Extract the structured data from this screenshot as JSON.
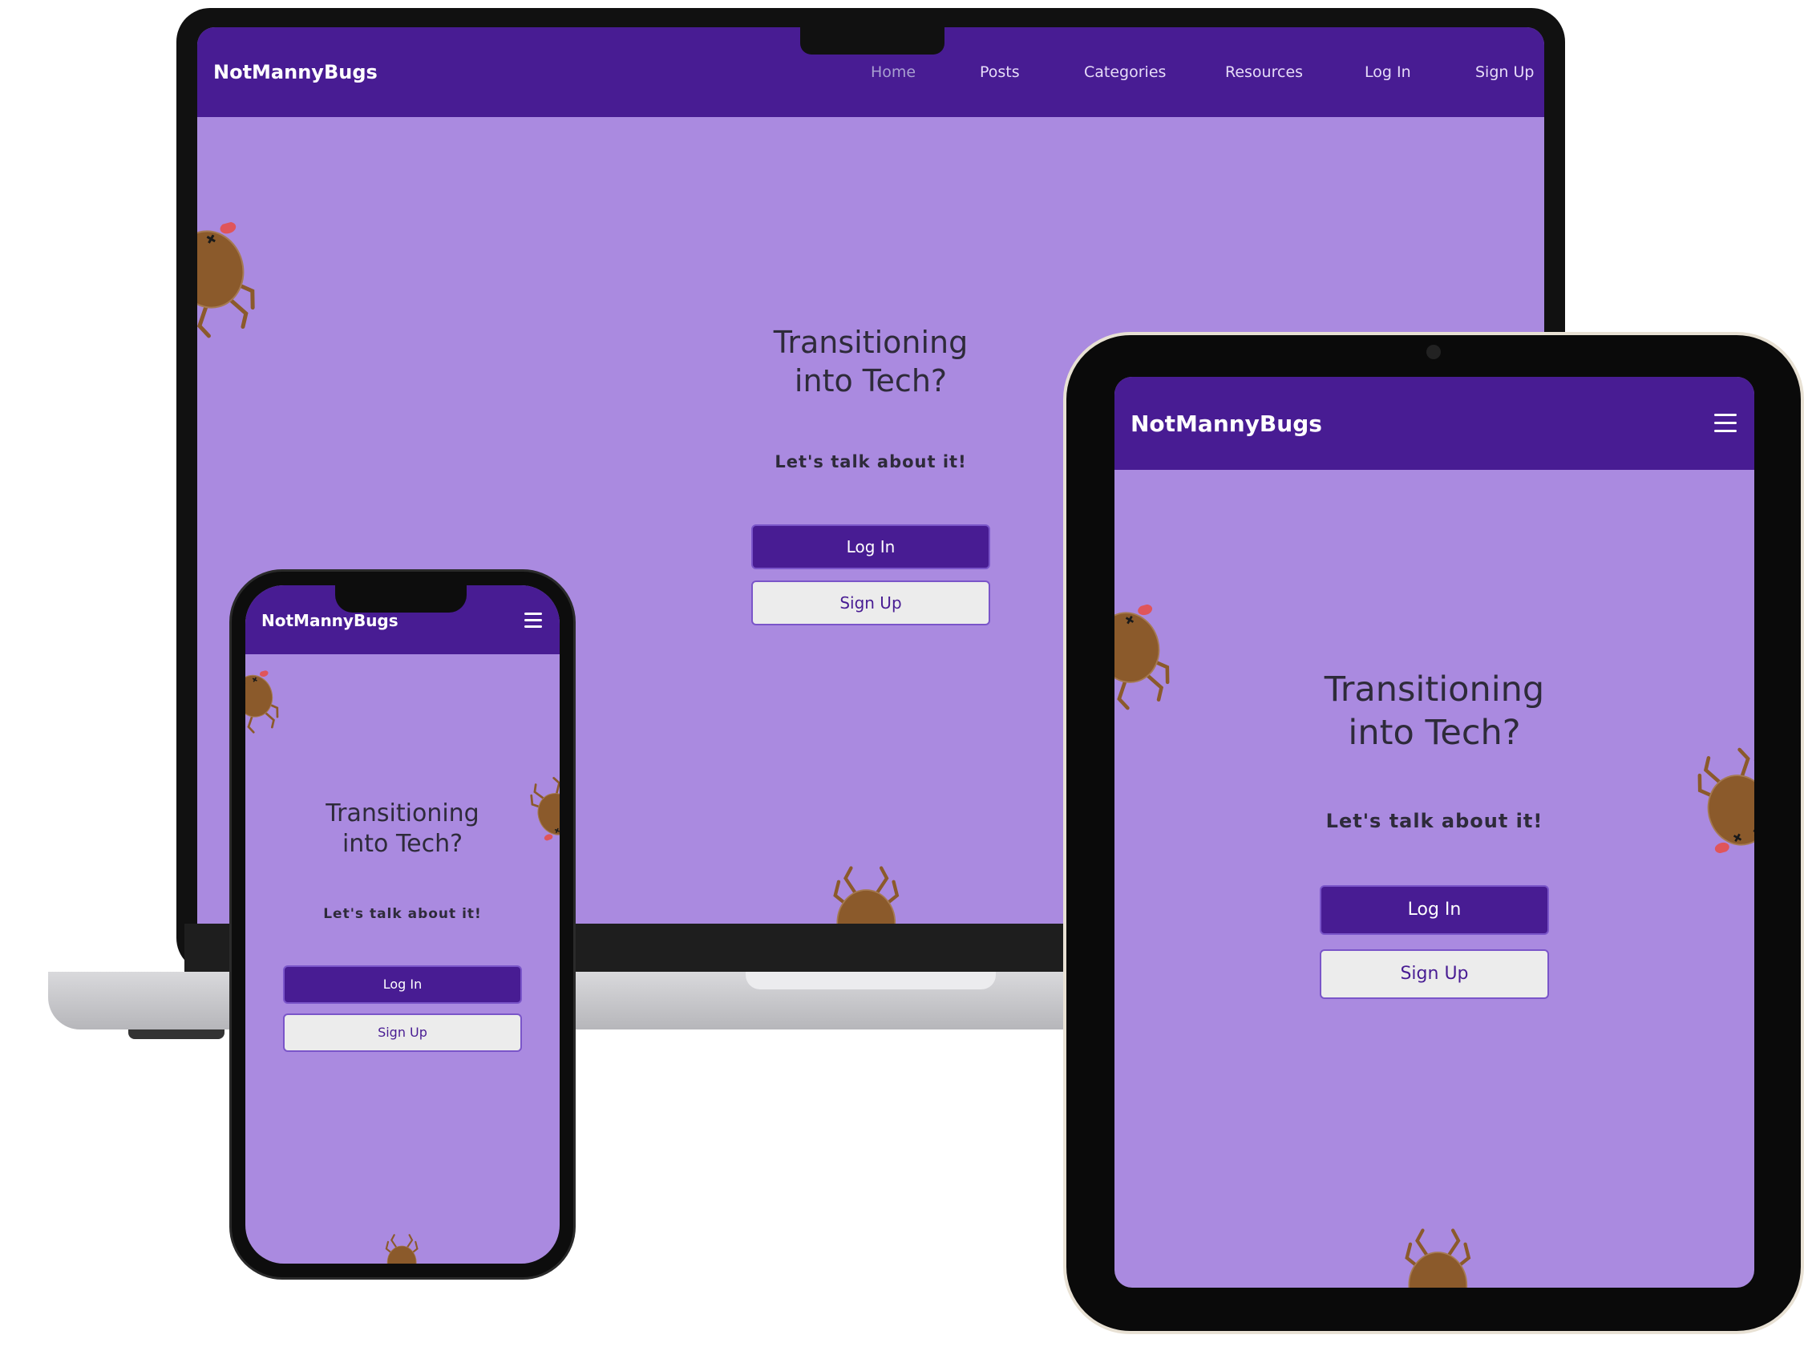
{
  "site": {
    "brand": "NotMannyBugs",
    "nav": [
      "Home",
      "Posts",
      "Categories",
      "Resources",
      "Log In",
      "Sign Up"
    ],
    "hero": {
      "title_line1": "Transitioning",
      "title_line2": "into Tech?",
      "subtitle": "Let's talk about it!",
      "login_label": "Log In",
      "signup_label": "Sign Up"
    }
  },
  "colors": {
    "navbar": "#481c93",
    "page_background": "#aa8ae0",
    "primary_button": "#481c93",
    "secondary_button": "#ececec",
    "bug_body": "#8b5a2b"
  },
  "icons": {
    "menu": "hamburger-menu-icon",
    "mascot": "upside-down-bug-mascot"
  }
}
